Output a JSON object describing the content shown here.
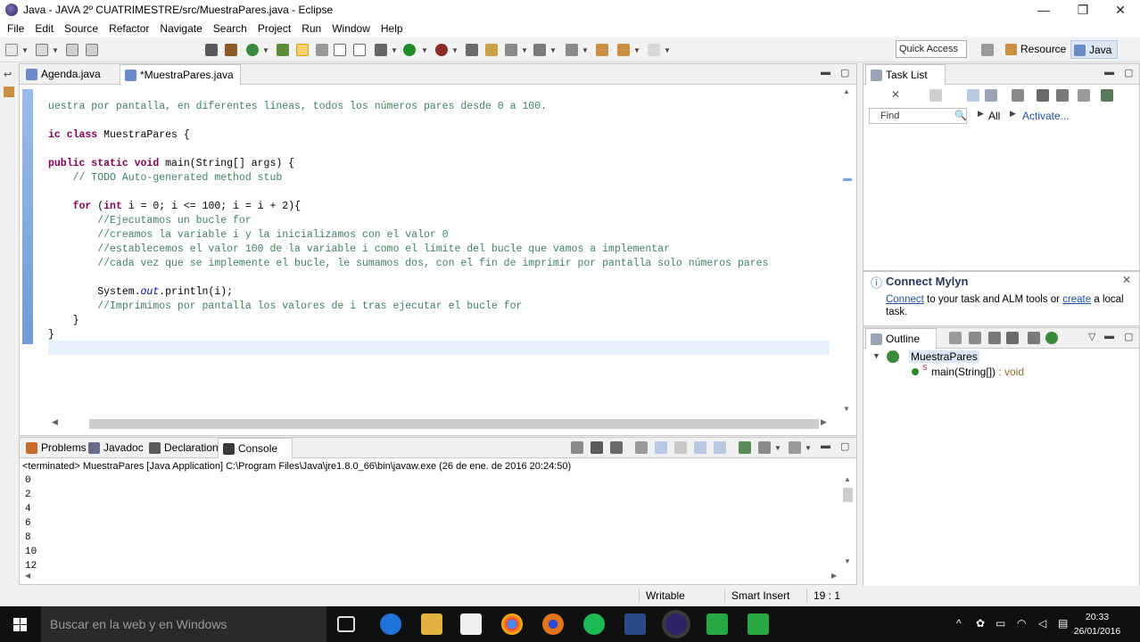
{
  "window": {
    "title": "Java - JAVA 2º CUATRIMESTRE/src/MuestraPares.java - Eclipse",
    "minimize": "—",
    "restore": "❐",
    "close": "✕"
  },
  "menu": [
    "File",
    "Edit",
    "Source",
    "Refactor",
    "Navigate",
    "Search",
    "Project",
    "Run",
    "Window",
    "Help"
  ],
  "toolbar": {
    "quick_access": "Quick Access",
    "perspective_resource": "Resource",
    "perspective_java": "Java"
  },
  "editor": {
    "tabs": [
      {
        "label": "Agenda.java"
      },
      {
        "label": "*MuestraPares.java"
      }
    ],
    "code_lines": [
      "uestra por pantalla, en diferentes líneas, todos los números pares desde 0 a 100.",
      "",
      "ic class MuestraPares {",
      "",
      "public static void main(String[] args) {",
      "    // TODO Auto-generated method stub",
      "",
      "    for (int i = 0; i <= 100; i = i + 2){",
      "        //Ejecutamos un bucle for",
      "        //creamos la variable i y la inicializamos con el valor 0",
      "        //establecemos el valor 100 de la variable i como el límite del bucle que vamos a implementar",
      "        //cada vez que se implemente el bucle, le sumamos dos, con el fin de imprimir por pantalla solo números pares",
      "",
      "        System.out.println(i);",
      "        //Imprimimos por pantalla los valores de i tras ejecutar el bucle for",
      "    }",
      "}"
    ]
  },
  "tasklist": {
    "tab": "Task List",
    "find_placeholder": "Find",
    "all": "All",
    "activate": "Activate..."
  },
  "mylyn": {
    "title": "Connect Mylyn",
    "connect": "Connect",
    "text1": " to your task and ALM tools or ",
    "create": "create",
    "text2": " a local",
    "text3": "task."
  },
  "outline": {
    "tab": "Outline",
    "class_name": "MuestraPares",
    "method": "main(String[])",
    "method_type": " : void"
  },
  "console": {
    "tabs": [
      "Problems",
      "Javadoc",
      "Declaration",
      "Console"
    ],
    "header": "<terminated> MuestraPares [Java Application] C:\\Program Files\\Java\\jre1.8.0_66\\bin\\javaw.exe (26 de ene. de 2016 20:24:50)",
    "output": [
      "0",
      "2",
      "4",
      "6",
      "8",
      "10",
      "12"
    ]
  },
  "status": {
    "writable": "Writable",
    "insert_mode": "Smart Insert",
    "position": "19 : 1"
  },
  "taskbar": {
    "search_placeholder": "Buscar en la web y en Windows",
    "time": "20:33",
    "date": "26/01/2016"
  }
}
